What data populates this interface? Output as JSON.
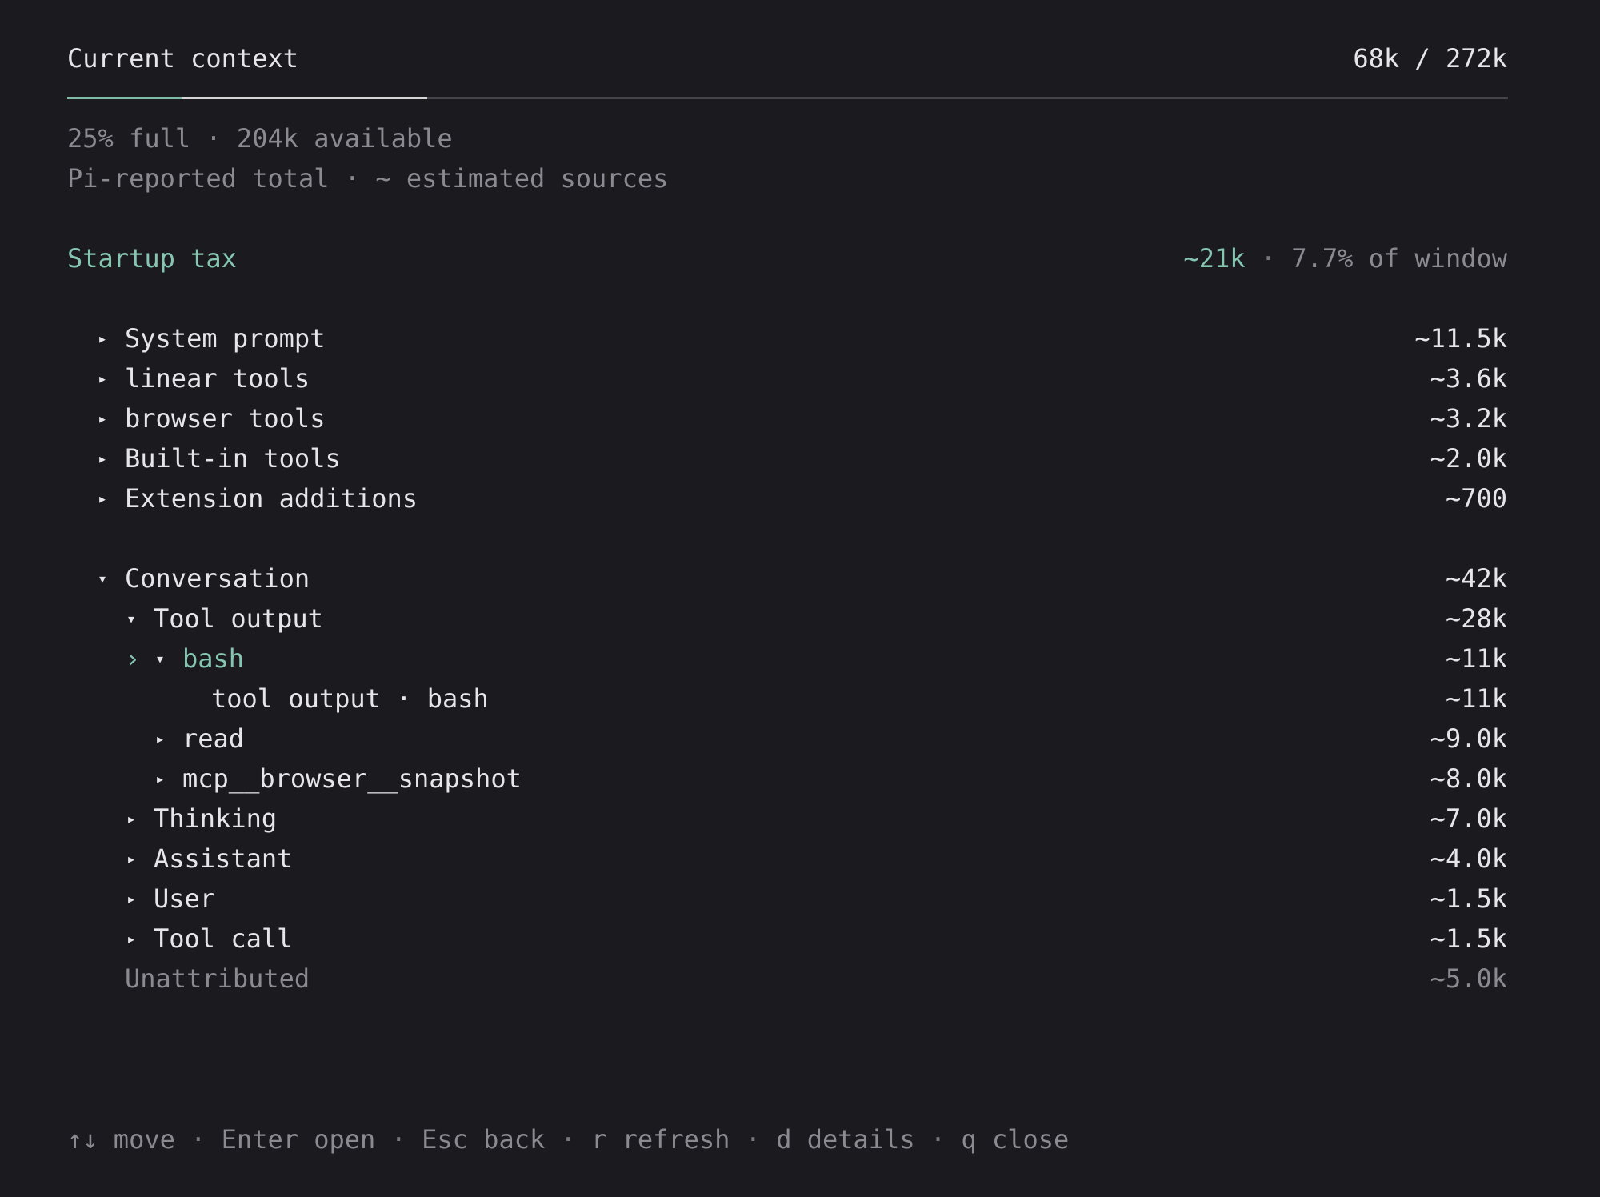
{
  "header": {
    "title": "Current context",
    "usage": "68k / 272k"
  },
  "usage_bar": {
    "conversation_fraction": 0.08,
    "startup_fraction": 0.17,
    "filled_fraction": 0.25,
    "colors": {
      "conversation": "#7fbba7",
      "startup": "#d6d6d6",
      "track": "#444449"
    }
  },
  "summary": {
    "line1": "25% full · 204k available",
    "line2": "Pi-reported total · ~ estimated sources"
  },
  "startup": {
    "label": "Startup tax",
    "tokens": "~21k",
    "sep": "·",
    "percent": "7.7% of window"
  },
  "startup_items": [
    {
      "marker": "▸",
      "label": "System prompt",
      "value": "~11.5k"
    },
    {
      "marker": "▸",
      "label": "linear tools",
      "value": "~3.6k"
    },
    {
      "marker": "▸",
      "label": "browser tools",
      "value": "~3.2k"
    },
    {
      "marker": "▸",
      "label": "Built-in tools",
      "value": "~2.0k"
    },
    {
      "marker": "▸",
      "label": "Extension additions",
      "value": "~700"
    }
  ],
  "conversation": {
    "marker": "▾",
    "label": "Conversation",
    "value": "~42k",
    "tool_output": {
      "marker": "▾",
      "label": "Tool output",
      "value": "~28k",
      "bash": {
        "cursor": "›",
        "marker": "▾",
        "label": "bash",
        "value": "~11k",
        "child_label": "tool output · bash",
        "child_value": "~11k"
      },
      "read": {
        "marker": "▸",
        "label": "read",
        "value": "~9.0k"
      },
      "snapshot": {
        "marker": "▸",
        "label": "mcp__browser__snapshot",
        "value": "~8.0k"
      }
    },
    "thinking": {
      "marker": "▸",
      "label": "Thinking",
      "value": "~7.0k"
    },
    "assistant": {
      "marker": "▸",
      "label": "Assistant",
      "value": "~4.0k"
    },
    "user": {
      "marker": "▸",
      "label": "User",
      "value": "~1.5k"
    },
    "tool_call": {
      "marker": "▸",
      "label": "Tool call",
      "value": "~1.5k"
    },
    "unattributed": {
      "label": "Unattributed",
      "value": "~5.0k"
    }
  },
  "footer": {
    "arrows": "↑↓",
    "k1": "move",
    "s1": "·",
    "k2": "Enter open",
    "s2": "·",
    "k3": "Esc back",
    "s3": "·",
    "k4": "r refresh",
    "s4": "·",
    "k5": "d details",
    "s5": "·",
    "k6": "q close"
  }
}
